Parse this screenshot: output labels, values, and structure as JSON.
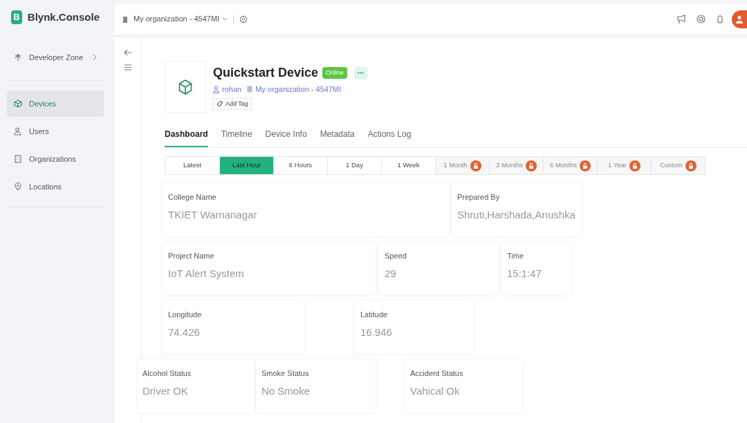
{
  "brand": {
    "logo_letter": "B",
    "name": "Blynk.Console"
  },
  "topbar": {
    "organization": "My organization - 4547MI"
  },
  "sidebar": {
    "items": [
      {
        "label": "Developer Zone",
        "kind": "expandable",
        "selected": false
      },
      {
        "label": "Devices",
        "kind": "link",
        "selected": true
      },
      {
        "label": "Users",
        "kind": "link",
        "selected": false
      },
      {
        "label": "Organizations",
        "kind": "link",
        "selected": false
      },
      {
        "label": "Locations",
        "kind": "link",
        "selected": false
      }
    ]
  },
  "device": {
    "name": "Quickstart Device",
    "status": "Online",
    "owner": "rohan",
    "organization": "My organization - 4547MI",
    "add_tag": "Add Tag"
  },
  "tabs": [
    {
      "label": "Dashboard",
      "selected": true
    },
    {
      "label": "Timeline",
      "selected": false
    },
    {
      "label": "Device Info",
      "selected": false
    },
    {
      "label": "Metadata",
      "selected": false
    },
    {
      "label": "Actions Log",
      "selected": false
    }
  ],
  "ranges": [
    {
      "label": "Latest",
      "selected": false,
      "locked": false
    },
    {
      "label": "Last Hour",
      "selected": true,
      "locked": false
    },
    {
      "label": "6 Hours",
      "selected": false,
      "locked": false
    },
    {
      "label": "1 Day",
      "selected": false,
      "locked": false
    },
    {
      "label": "1 Week",
      "selected": false,
      "locked": false
    },
    {
      "label": "1 Month",
      "selected": false,
      "locked": true
    },
    {
      "label": "3 Months",
      "selected": false,
      "locked": true
    },
    {
      "label": "6 Months",
      "selected": false,
      "locked": true
    },
    {
      "label": "1 Year",
      "selected": false,
      "locked": true
    },
    {
      "label": "Custom",
      "selected": false,
      "locked": true
    }
  ],
  "widget_rows": [
    [
      {
        "label": "College Name",
        "value": "TKIET Warnanagar"
      },
      {
        "label": "Prepared By",
        "value": "Shruti,Harshada,Anushka"
      }
    ],
    [
      {
        "label": "Project Name",
        "value": "IoT Alert System"
      },
      {
        "label": "Speed",
        "value": "29"
      },
      {
        "label": "Time",
        "value": "15:1:47"
      }
    ],
    [
      {
        "label": "Longitude",
        "value": "74.426"
      },
      {
        "label": "Latitude",
        "value": "16.946"
      }
    ],
    [
      {
        "label": "Alcohol Status",
        "value": "Driver OK"
      },
      {
        "label": "Smoke Status",
        "value": "No Smoke"
      },
      {
        "label": "Accident Status",
        "value": "Vahical Ok"
      }
    ]
  ]
}
